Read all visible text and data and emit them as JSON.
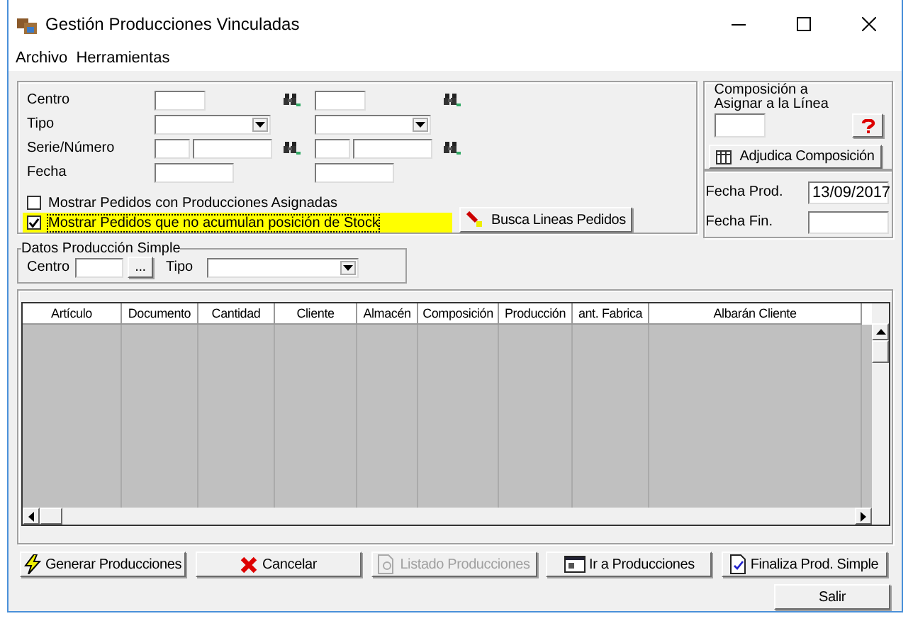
{
  "window": {
    "title": "Gestión Producciones Vinculadas"
  },
  "menu": [
    "Archivo",
    "Herramientas"
  ],
  "filters": {
    "rows": [
      {
        "label": "Centro",
        "kind": "lookup"
      },
      {
        "label": "Tipo",
        "kind": "combo"
      },
      {
        "label": "Serie/Número",
        "kind": "serie"
      },
      {
        "label": "Fecha",
        "kind": "date"
      }
    ],
    "checkboxes": [
      {
        "label": "Mostrar Pedidos con Producciones Asignadas",
        "checked": false,
        "highlighted": false
      },
      {
        "label": "Mostrar Pedidos que no acumulan posición de Stock",
        "checked": true,
        "highlighted": true
      }
    ],
    "search_button": "Busca Lineas Pedidos"
  },
  "composition": {
    "title": "Composición a Asignar a la Línea",
    "button": "Adjudica Composición"
  },
  "dates": [
    {
      "label": "Fecha Prod.",
      "value": "13/09/2017"
    },
    {
      "label": "Fecha Fin."
    }
  ],
  "simple": {
    "title": "Datos Producción Simple",
    "centro_label": "Centro",
    "browse": "...",
    "tipo_label": "Tipo"
  },
  "table": {
    "columns": [
      "Artículo",
      "Documento",
      "Cantidad",
      "Cliente",
      "Almacén",
      "Composición",
      "Producción",
      "ant. Fabrica",
      "Albarán Cliente"
    ]
  },
  "buttons": [
    {
      "label": "Generar Producciones",
      "kind": "lightning",
      "disabled": false
    },
    {
      "label": "Cancelar",
      "kind": "cross",
      "disabled": false
    },
    {
      "label": "Listado Producciones",
      "kind": "report",
      "disabled": true
    },
    {
      "label": "Ir a Producciones",
      "kind": "window",
      "disabled": false
    },
    {
      "label": "Finaliza Prod. Simple",
      "kind": "document",
      "disabled": false
    }
  ],
  "exit_button": "Salir"
}
